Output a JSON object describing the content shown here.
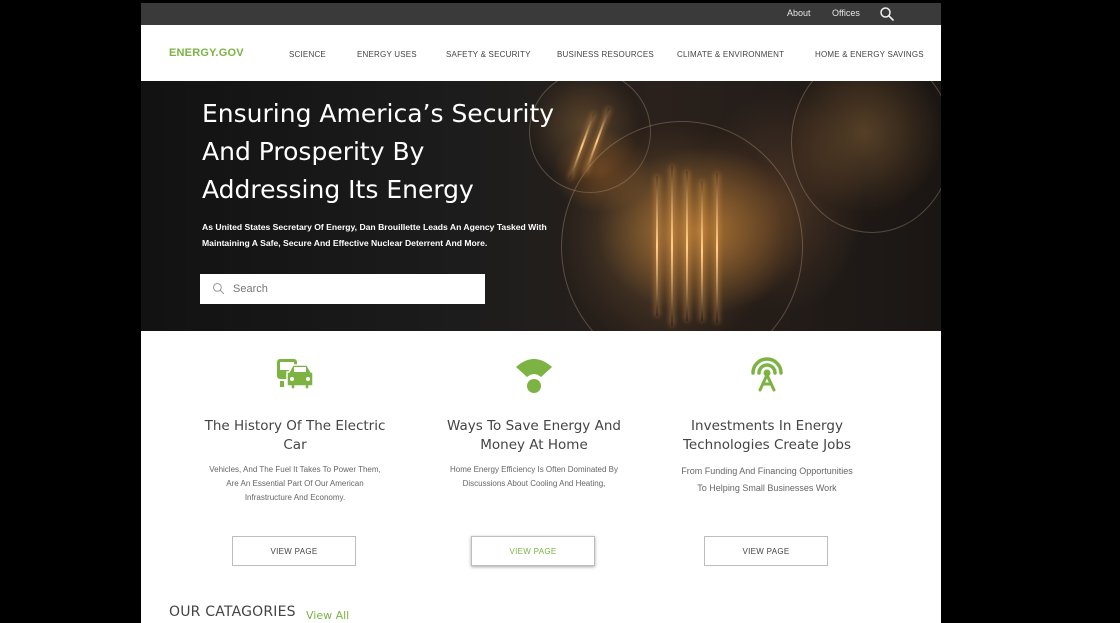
{
  "utility": {
    "links": [
      "About",
      "Offices"
    ],
    "search_icon": "search-icon"
  },
  "nav": {
    "brand": "ENERGY.GOV",
    "items": [
      "SCIENCE",
      "ENERGY USES",
      "SAFETY & SECURITY",
      "BUSINESS RESOURCES",
      "CLIMATE & ENVIRONMENT",
      "HOME & ENERGY SAVINGS"
    ]
  },
  "hero": {
    "title": "Ensuring America’s Security And Prosperity By Addressing Its Energy",
    "subtitle": "As United States Secretary Of Energy, Dan Brouillette Leads An Agency Tasked With Maintaining A Safe, Secure And Effective Nuclear Deterrent And More.",
    "search_placeholder": "Search"
  },
  "cards": [
    {
      "icon": "vehicles-icon",
      "title": "The History Of The Electric Car",
      "description": "Vehicles, And The Fuel It Takes To Power Them, Are An Essential Part Of Our American Infrastructure And Economy.",
      "button": "VIEW PAGE"
    },
    {
      "icon": "wifi-icon",
      "title": "Ways To Save Energy And Money At Home",
      "description": "Home Energy Efficiency Is Often Dominated By Discussions About Cooling And Heating,",
      "button": "VIEW PAGE"
    },
    {
      "icon": "antenna-icon",
      "title": "Investments In Energy Technologies Create Jobs",
      "description": "From Funding And Financing Opportunities To Helping Small Businesses Work",
      "button": "VIEW PAGE"
    }
  ],
  "categories": {
    "heading": "OUR CATAGORIES",
    "view_all": "View All"
  },
  "colors": {
    "accent": "#7cb342",
    "utility_bar": "#3a3a3a"
  }
}
